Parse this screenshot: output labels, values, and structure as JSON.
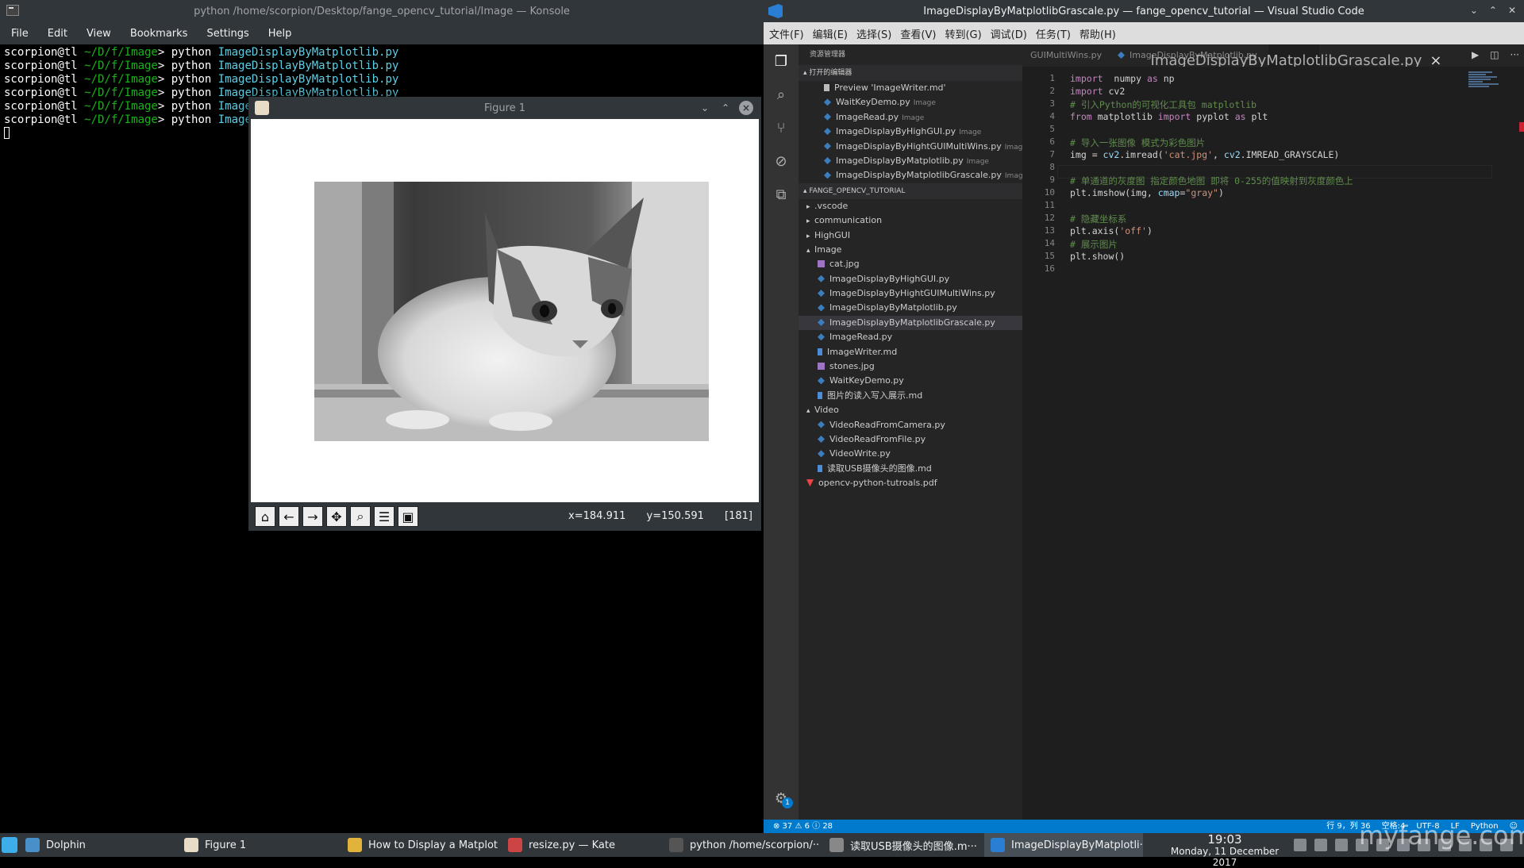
{
  "konsole": {
    "title": "python /home/scorpion/Desktop/fange_opencv_tutorial/Image — Konsole",
    "menu": [
      "File",
      "Edit",
      "View",
      "Bookmarks",
      "Settings",
      "Help"
    ],
    "prompt_user": "scorpion@tl",
    "prompt_path": " ~/D/f/Image",
    "prompt_sign": "> ",
    "command": "python ",
    "lines": [
      "ImageDisplayByMatplotlib.py",
      "ImageDisplayByMatplotlib.py",
      "ImageDisplayByMatplotlib.py",
      "ImageDisplayByMatplotlib.py",
      "ImageDisplayByMatplotlibGrascale.py",
      "ImageDisplayByMatplotlibGrascale.py"
    ]
  },
  "figure": {
    "title": "Figure 1",
    "x_readout": "x=184.911",
    "y_readout": "y=150.591",
    "value_readout": "[181]",
    "toolbar_icons": [
      "home-icon",
      "back-icon",
      "forward-icon",
      "pan-icon",
      "zoom-icon",
      "configure-subplots-icon",
      "save-icon"
    ]
  },
  "vscode": {
    "title": "ImageDisplayByMatplotlibGrascale.py — fange_opencv_tutorial — Visual Studio Code",
    "menu": [
      "文件(F)",
      "编辑(E)",
      "选择(S)",
      "查看(V)",
      "转到(G)",
      "调试(D)",
      "任务(T)",
      "帮助(H)"
    ],
    "explorer_title": "资源管理器",
    "open_editors_header": "▴ 打开的编辑器",
    "open_editors": [
      {
        "name": "Preview 'ImageWriter.md'",
        "hint": "",
        "type": "pv"
      },
      {
        "name": "WaitKeyDemo.py",
        "hint": "Image",
        "type": "py"
      },
      {
        "name": "ImageRead.py",
        "hint": "Image",
        "type": "py"
      },
      {
        "name": "ImageDisplayByHighGUI.py",
        "hint": "Image",
        "type": "py"
      },
      {
        "name": "ImageDisplayByHightGUIMultiWins.py",
        "hint": "Image",
        "type": "py"
      },
      {
        "name": "ImageDisplayByMatplotlib.py",
        "hint": "Image",
        "type": "py"
      },
      {
        "name": "ImageDisplayByMatplotlibGrascale.py",
        "hint": "Image",
        "type": "py"
      }
    ],
    "project_header": "▴ FANGE_OPENCV_TUTORIAL",
    "tree": [
      {
        "name": ".vscode",
        "indent": 1,
        "chev": "▸",
        "type": ""
      },
      {
        "name": "communication",
        "indent": 1,
        "chev": "▸",
        "type": ""
      },
      {
        "name": "HighGUI",
        "indent": 1,
        "chev": "▸",
        "type": ""
      },
      {
        "name": "Image",
        "indent": 1,
        "chev": "▴",
        "type": ""
      },
      {
        "name": "cat.jpg",
        "indent": 2,
        "chev": "",
        "type": "img"
      },
      {
        "name": "ImageDisplayByHighGUI.py",
        "indent": 2,
        "chev": "",
        "type": "py"
      },
      {
        "name": "ImageDisplayByHightGUIMultiWins.py",
        "indent": 2,
        "chev": "",
        "type": "py"
      },
      {
        "name": "ImageDisplayByMatplotlib.py",
        "indent": 2,
        "chev": "",
        "type": "py"
      },
      {
        "name": "ImageDisplayByMatplotlibGrascale.py",
        "indent": 2,
        "chev": "",
        "type": "py",
        "selected": true
      },
      {
        "name": "ImageRead.py",
        "indent": 2,
        "chev": "",
        "type": "py"
      },
      {
        "name": "ImageWriter.md",
        "indent": 2,
        "chev": "",
        "type": "md"
      },
      {
        "name": "stones.jpg",
        "indent": 2,
        "chev": "",
        "type": "img"
      },
      {
        "name": "WaitKeyDemo.py",
        "indent": 2,
        "chev": "",
        "type": "py"
      },
      {
        "name": "图片的读入写入展示.md",
        "indent": 2,
        "chev": "",
        "type": "md"
      },
      {
        "name": "Video",
        "indent": 1,
        "chev": "▴",
        "type": ""
      },
      {
        "name": "VideoReadFromCamera.py",
        "indent": 2,
        "chev": "",
        "type": "py"
      },
      {
        "name": "VideoReadFromFile.py",
        "indent": 2,
        "chev": "",
        "type": "py"
      },
      {
        "name": "VideoWrite.py",
        "indent": 2,
        "chev": "",
        "type": "py"
      },
      {
        "name": "读取USB摄像头的图像.md",
        "indent": 2,
        "chev": "",
        "type": "md"
      },
      {
        "name": "opencv-python-tutroals.pdf",
        "indent": 1,
        "chev": "",
        "type": "pdf"
      }
    ],
    "tabs": [
      {
        "label": "GUIMultiWins.py",
        "active": false
      },
      {
        "label": "ImageDisplayByMatplotlib.py",
        "active": false
      },
      {
        "label": "ImageDisplayByMatplotlibGrascale.py",
        "active": true
      }
    ],
    "tab_close": "×",
    "code": [
      [
        [
          "kw2",
          "import"
        ],
        [
          "",
          "  numpy "
        ],
        [
          "kw2",
          "as"
        ],
        [
          "",
          " np"
        ]
      ],
      [
        [
          "kw2",
          "import"
        ],
        [
          "",
          " cv2"
        ]
      ],
      [
        [
          "cm",
          "# 引入Python的可视化工具包 matplotlib"
        ]
      ],
      [
        [
          "kw2",
          "from"
        ],
        [
          "",
          " matplotlib "
        ],
        [
          "kw2",
          "import"
        ],
        [
          "",
          " pyplot "
        ],
        [
          "kw2",
          "as"
        ],
        [
          "",
          " plt"
        ]
      ],
      [],
      [
        [
          "cm",
          "# 导入一张图像 模式为彩色图片"
        ]
      ],
      [
        [
          "",
          "img = "
        ],
        [
          "id",
          "cv2"
        ],
        [
          "",
          ".imread("
        ],
        [
          "str",
          "'cat.jpg'"
        ],
        [
          "",
          ", "
        ],
        [
          "id",
          "cv2"
        ],
        [
          "",
          ".IMREAD_GRAYSCALE)"
        ]
      ],
      [],
      [
        [
          "cm",
          "# 单通道的灰度图 指定颜色地图 即将 0-255的值映射到灰度颜色上"
        ]
      ],
      [
        [
          "",
          "plt.imshow(img, "
        ],
        [
          "id",
          "cmap"
        ],
        [
          "",
          "="
        ],
        [
          "str",
          "\"gray\""
        ],
        [
          "",
          ")"
        ]
      ],
      [],
      [
        [
          "cm",
          "# 隐藏坐标系"
        ]
      ],
      [
        [
          "",
          "plt.axis("
        ],
        [
          "str",
          "'off'"
        ],
        [
          "",
          ")"
        ]
      ],
      [
        [
          "cm",
          "# 展示图片"
        ]
      ],
      [
        [
          "",
          "plt.show()"
        ]
      ],
      []
    ],
    "status_left": "⊗ 37  ⚠ 6  ⓘ 28",
    "status_right": [
      "行 9，列 36",
      "空格:4",
      "UTF-8",
      "LF",
      "Python",
      "☺"
    ],
    "activity_icons": [
      "files-icon",
      "search-icon",
      "source-control-icon",
      "debug-icon",
      "extensions-icon"
    ],
    "settings_badge": "1"
  },
  "taskbar": {
    "items": [
      {
        "label": "Dolphin",
        "color": "#4a90c8",
        "active": false
      },
      {
        "label": "Figure 1",
        "color": "#e8dcc7",
        "active": false
      },
      {
        "label": "How to Display a Matplot···",
        "color": "#e2b33a",
        "active": false
      },
      {
        "label": "resize.py — Kate",
        "color": "#c44",
        "active": false
      },
      {
        "label": "python  /home/scorpion/···",
        "color": "#555",
        "active": false
      },
      {
        "label": "读取USB摄像头的图像.m···",
        "color": "#888",
        "active": false
      },
      {
        "label": "ImageDisplayByMatplotli···",
        "color": "#2a7fd4",
        "active": true
      }
    ],
    "time": "19:03",
    "date": "Monday, 11 December 2017"
  },
  "watermark": "myfange.com"
}
